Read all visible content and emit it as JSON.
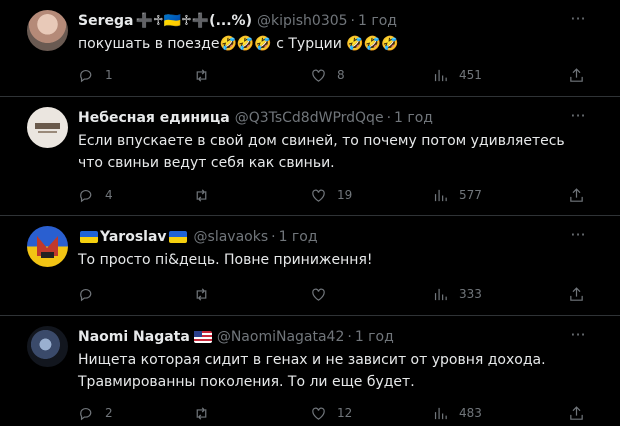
{
  "tweets": [
    {
      "name": "Serega",
      "name_extra": "➕♱🇺🇦♱➕(...%)",
      "handle": "@kipish0305",
      "time": "1 год",
      "text": "покушать в поезде🤣🤣🤣 с Турции 🤣🤣🤣",
      "replies": "1",
      "retweets": "",
      "likes": "8",
      "views": "451"
    },
    {
      "name": "Небесная единица",
      "name_extra": "",
      "handle": "@Q3TsCd8dWPrdQqe",
      "time": "1 год",
      "text": "Если впускаете в свой дом свиней, то почему потом удивляетесь что свиньи ведут себя как свиньи.",
      "replies": "4",
      "retweets": "",
      "likes": "19",
      "views": "577"
    },
    {
      "name": "Yaroslav",
      "name_extra": "",
      "handle": "@slavaoks",
      "time": "1 год",
      "text": "То просто пі&дець. Повне приниження!",
      "replies": "",
      "retweets": "",
      "likes": "",
      "views": "333"
    },
    {
      "name": "Naomi Nagata",
      "name_extra": "",
      "handle": "@NaomiNagata42",
      "time": "1 год",
      "text": "Нищета которая сидит в генах и не зависит от уровня дохода. Травмированны поколения. То ли еще будет.",
      "replies": "2",
      "retweets": "",
      "likes": "12",
      "views": "483"
    }
  ],
  "ui": {
    "separator": "·",
    "more_glyph": "···"
  },
  "colors": {
    "background": "#000000",
    "text_primary": "#e7e9ea",
    "text_secondary": "#71767b",
    "divider": "#2f3336"
  }
}
